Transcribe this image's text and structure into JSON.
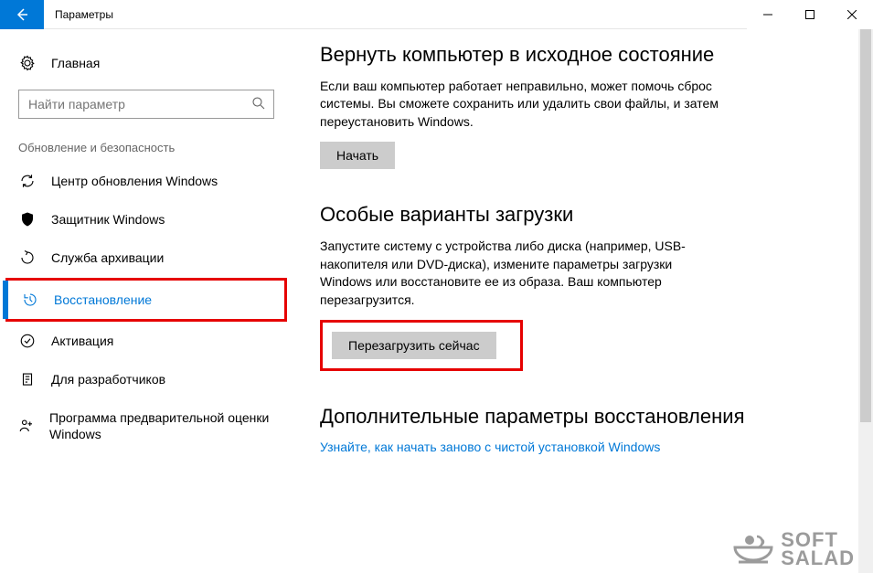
{
  "titlebar": {
    "title": "Параметры"
  },
  "sidebar": {
    "home": "Главная",
    "search_placeholder": "Найти параметр",
    "section_label": "Обновление и безопасность",
    "items": [
      {
        "label": "Центр обновления Windows"
      },
      {
        "label": "Защитник Windows"
      },
      {
        "label": "Служба архивации"
      },
      {
        "label": "Восстановление"
      },
      {
        "label": "Активация"
      },
      {
        "label": "Для разработчиков"
      },
      {
        "label": "Программа предварительной оценки Windows"
      }
    ]
  },
  "main": {
    "reset": {
      "heading": "Вернуть компьютер в исходное состояние",
      "body": "Если ваш компьютер работает неправильно, может помочь сброс системы. Вы сможете сохранить или удалить свои файлы, и затем переустановить Windows.",
      "button": "Начать"
    },
    "advanced_startup": {
      "heading": "Особые варианты загрузки",
      "body": "Запустите систему с устройства либо диска (например, USB-накопителя или DVD-диска), измените параметры загрузки Windows или восстановите ее из образа. Ваш компьютер перезагрузится.",
      "button": "Перезагрузить сейчас"
    },
    "more": {
      "heading": "Дополнительные параметры восстановления",
      "link": "Узнайте, как начать заново с чистой установкой Windows"
    }
  },
  "watermark": {
    "line1": "SOFT",
    "line2": "SALAD"
  }
}
